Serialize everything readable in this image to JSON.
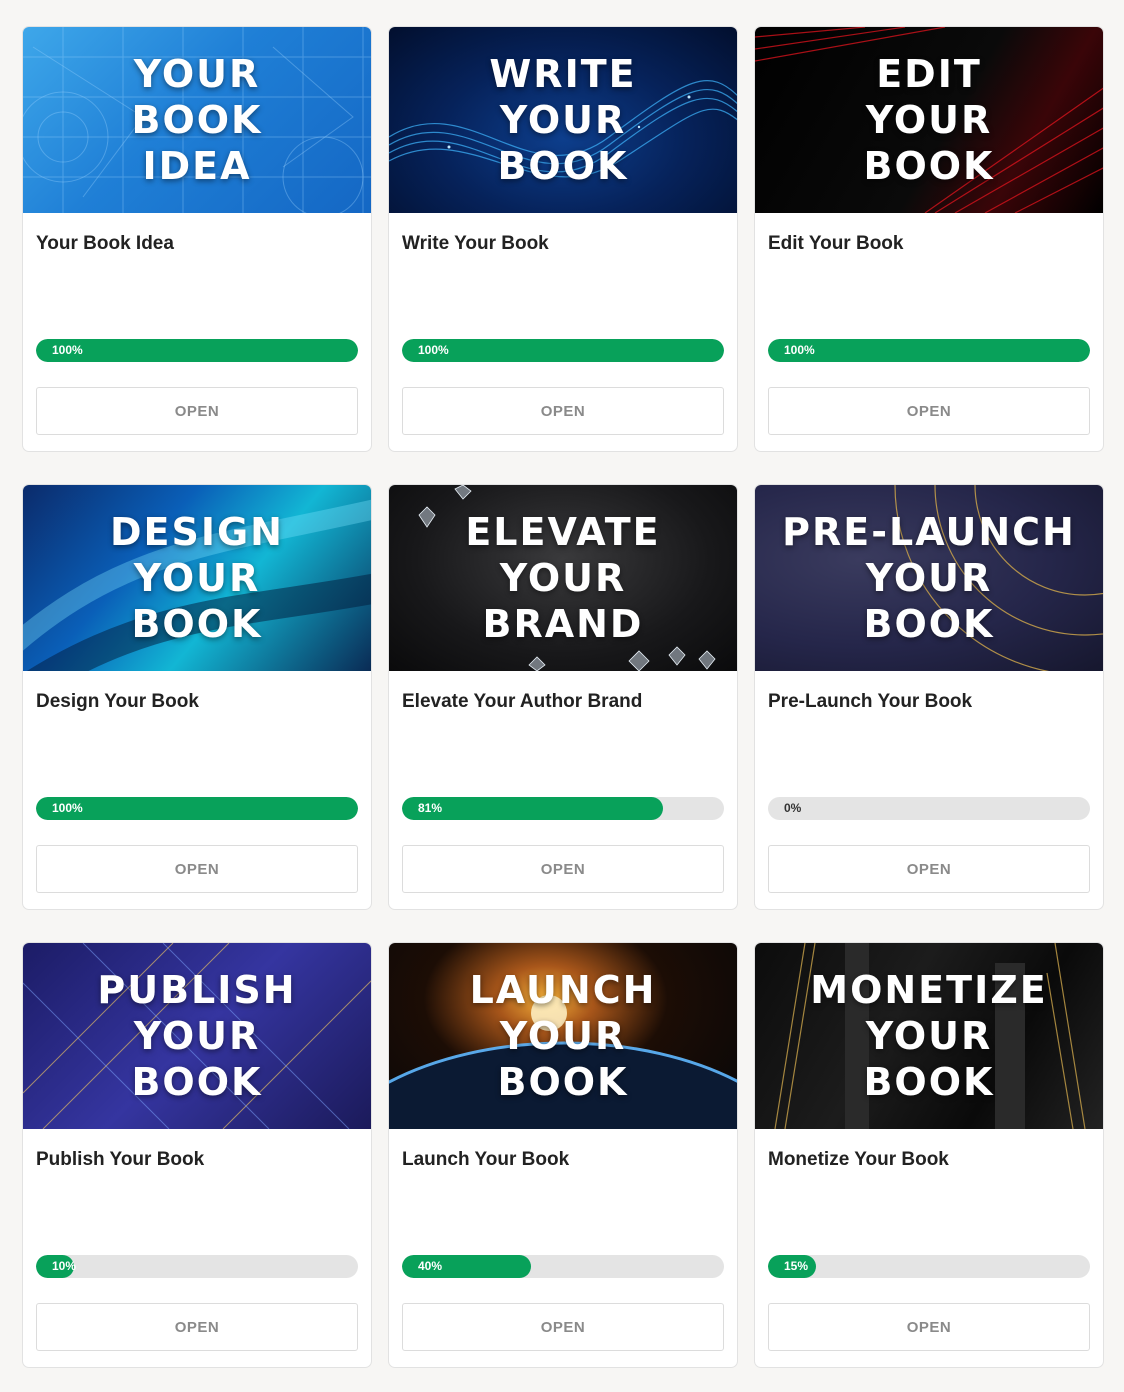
{
  "courses": [
    {
      "banner": "YOUR\nBOOK\nIDEA",
      "title": "Your Book Idea",
      "progress_label": "100%",
      "progress": 100,
      "button": "OPEN"
    },
    {
      "banner": "WRITE\nYOUR\nBOOK",
      "title": "Write Your Book",
      "progress_label": "100%",
      "progress": 100,
      "button": "OPEN"
    },
    {
      "banner": "EDIT\nYOUR\nBOOK",
      "title": "Edit Your Book",
      "progress_label": "100%",
      "progress": 100,
      "button": "OPEN"
    },
    {
      "banner": "DESIGN\nYOUR\nBOOK",
      "title": "Design Your Book",
      "progress_label": "100%",
      "progress": 100,
      "button": "OPEN"
    },
    {
      "banner": "ELEVATE\nYOUR\nBRAND",
      "title": "Elevate Your Author Brand",
      "progress_label": "81%",
      "progress": 81,
      "button": "OPEN"
    },
    {
      "banner": "PRE-LAUNCH\nYOUR\nBOOK",
      "title": "Pre-Launch Your Book",
      "progress_label": "0%",
      "progress": 0,
      "button": "OPEN"
    },
    {
      "banner": "PUBLISH\nYOUR\nBOOK",
      "title": "Publish Your Book",
      "progress_label": "10%",
      "progress": 10,
      "button": "OPEN"
    },
    {
      "banner": "LAUNCH\nYOUR\nBOOK",
      "title": "Launch Your Book",
      "progress_label": "40%",
      "progress": 40,
      "button": "OPEN"
    },
    {
      "banner": "MONETIZE\nYOUR\nBOOK",
      "title": "Monetize Your Book",
      "progress_label": "15%",
      "progress": 15,
      "button": "OPEN"
    }
  ],
  "colors": {
    "progress_fill": "#08a15a",
    "progress_track": "#e4e4e4",
    "page_background": "#f7f6f4"
  }
}
